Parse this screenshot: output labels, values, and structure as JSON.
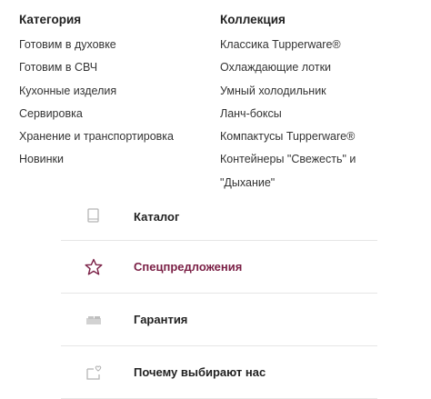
{
  "categories": {
    "heading": "Категория",
    "items": [
      "Готовим в духовке",
      "Готовим в СВЧ",
      "Кухонные изделия",
      "Сервировка",
      "Хранение и транспортировка",
      "Новинки"
    ]
  },
  "collections": {
    "heading": "Коллекция",
    "items": [
      "Классика Tupperware®",
      "Охлаждающие лотки",
      "Умный холодильник",
      "Ланч-боксы",
      "Компактусы Tupperware®",
      "Контейнеры \"Свежесть\" и \"Дыхание\""
    ]
  },
  "menu": {
    "items": [
      {
        "label": "Каталог",
        "icon": "book-icon"
      },
      {
        "label": "Спецпредложения",
        "icon": "star-icon",
        "active": true
      },
      {
        "label": "Гарантия",
        "icon": "guarantee-icon"
      },
      {
        "label": "Почему выбирают нас",
        "icon": "heart-box-icon"
      }
    ]
  },
  "colors": {
    "text": "#222222",
    "accent": "#7a1f45",
    "icon_gray": "#b5b5b5",
    "divider": "#e6e6e6"
  }
}
